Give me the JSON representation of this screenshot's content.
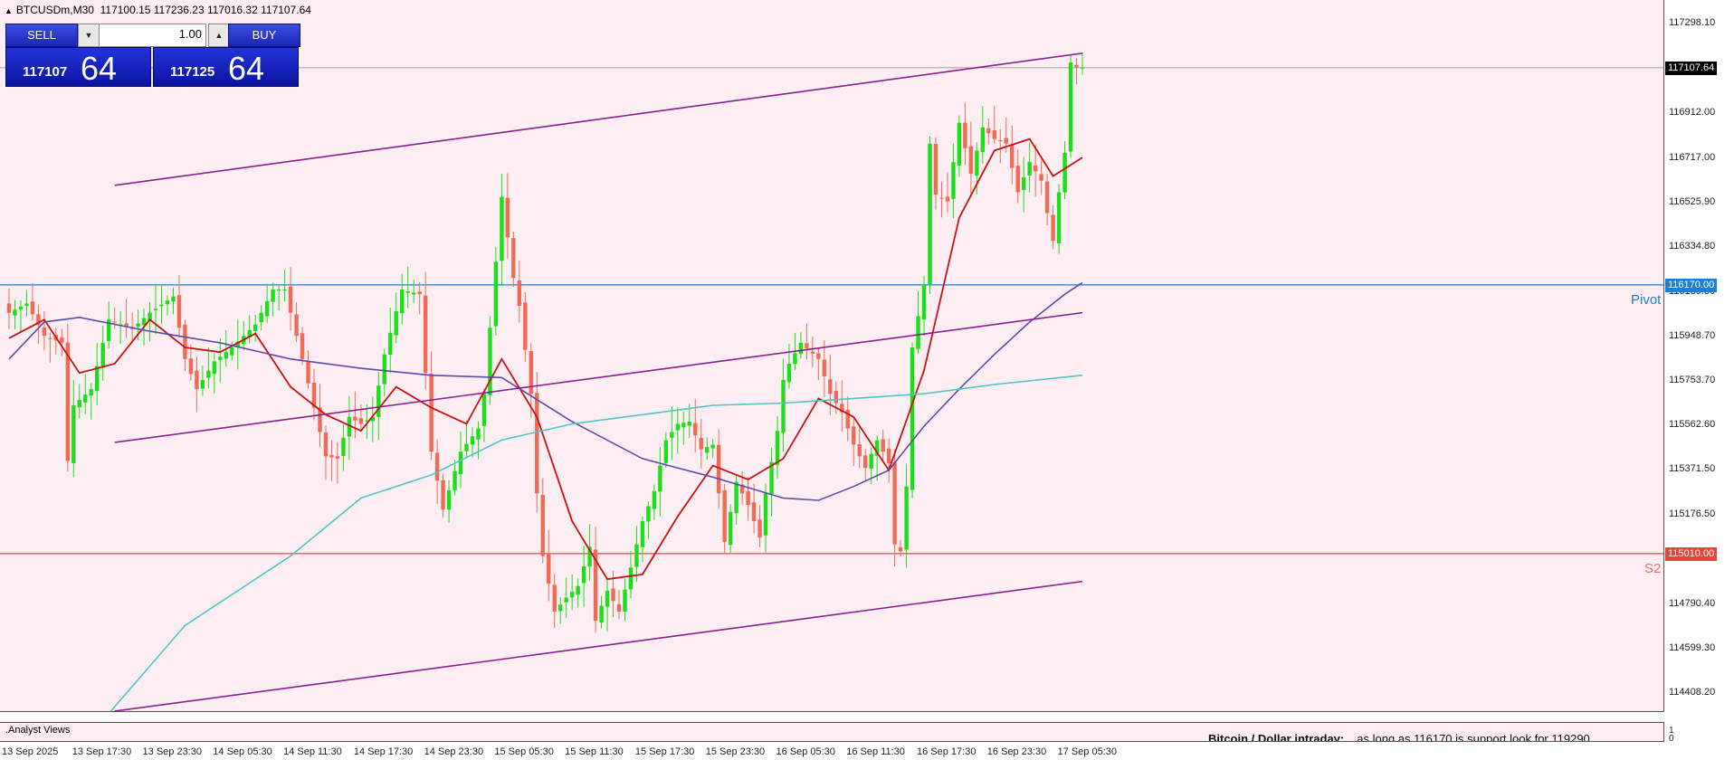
{
  "header": {
    "symbol": "BTCUSDm,M30",
    "ohlc": "117100.15 117236.23 117016.32 117107.64"
  },
  "trade_panel": {
    "sell_label": "SELL",
    "buy_label": "BUY",
    "lot_value": "1.00",
    "sell_price_main": "117107",
    "sell_price_big": "64",
    "buy_price_main": "117125",
    "buy_price_big": "64",
    "down_glyph": "▼",
    "up_glyph": "▲"
  },
  "levels": {
    "current_price": "117107.64",
    "pivot_label": "Pivot",
    "pivot_value": "116170.00",
    "s2_label": "S2",
    "s2_value": "115010.00"
  },
  "sub_panel": {
    "title": ".Analyst Views",
    "scale_top": "1",
    "scale_bottom": "0",
    "analyst_heading": "Bitcoin / Dollar intraday:",
    "analyst_body": "as long as 116170 is support look for 119290"
  },
  "colors": {
    "background": "#fdeef3",
    "bull": "#19e019",
    "bear": "#ef6b55",
    "ma_fast": "#cc1111",
    "ma_mid": "#5a4bb0",
    "ma_slow": "#4ec5c8",
    "channel": "#8d1d8f",
    "pivot": "#1f7fd0",
    "s2": "#e5463b"
  },
  "chart_data": {
    "type": "candlestick",
    "timeframe": "M30",
    "y_ticks": [
      117298.1,
      116912.0,
      116717.0,
      116525.9,
      116334.8,
      116139.8,
      115948.7,
      115753.7,
      115562.6,
      115371.5,
      115176.5,
      114985.4,
      114790.4,
      114599.3,
      114408.2
    ],
    "y_tick_labels": [
      "117298.10",
      "116912.00",
      "116717.00",
      "116525.90",
      "116334.80",
      "116139.80",
      "115948.70",
      "115753.70",
      "115562.60",
      "115371.50",
      "115176.50",
      "114985.40",
      "114790.40",
      "114599.30",
      "114408.20"
    ],
    "ylim": [
      114330,
      117400
    ],
    "x_labels": [
      "13 Sep 2025",
      "13 Sep 17:30",
      "13 Sep 23:30",
      "14 Sep 05:30",
      "14 Sep 11:30",
      "14 Sep 17:30",
      "14 Sep 23:30",
      "15 Sep 05:30",
      "15 Sep 11:30",
      "15 Sep 17:30",
      "15 Sep 23:30",
      "16 Sep 05:30",
      "16 Sep 11:30",
      "16 Sep 17:30",
      "16 Sep 23:30",
      "17 Sep 05:30"
    ],
    "x_label_bars": [
      0,
      12,
      24,
      36,
      48,
      60,
      72,
      84,
      96,
      108,
      120,
      132,
      144,
      156,
      168,
      180
    ],
    "bars_total": 184,
    "waypoints": [
      [
        0,
        116050
      ],
      [
        3,
        116090
      ],
      [
        6,
        115950
      ],
      [
        9,
        115920
      ],
      [
        10,
        115410
      ],
      [
        11,
        115650
      ],
      [
        14,
        115720
      ],
      [
        17,
        116020
      ],
      [
        21,
        115980
      ],
      [
        24,
        116050
      ],
      [
        28,
        116120
      ],
      [
        30,
        115850
      ],
      [
        32,
        115720
      ],
      [
        35,
        115840
      ],
      [
        38,
        115900
      ],
      [
        42,
        116000
      ],
      [
        45,
        116150
      ],
      [
        47,
        116150
      ],
      [
        50,
        115850
      ],
      [
        54,
        115430
      ],
      [
        56,
        115420
      ],
      [
        58,
        115600
      ],
      [
        60,
        115570
      ],
      [
        62,
        115600
      ],
      [
        64,
        115870
      ],
      [
        67,
        116150
      ],
      [
        70,
        116130
      ],
      [
        72,
        115450
      ],
      [
        74,
        115200
      ],
      [
        77,
        115450
      ],
      [
        80,
        115550
      ],
      [
        81,
        115700
      ],
      [
        83,
        116270
      ],
      [
        84,
        116550
      ],
      [
        86,
        116200
      ],
      [
        87,
        116080
      ],
      [
        89,
        115700
      ],
      [
        90,
        115270
      ],
      [
        91,
        115000
      ],
      [
        93,
        114760
      ],
      [
        95,
        114820
      ],
      [
        97,
        114870
      ],
      [
        99,
        115040
      ],
      [
        100,
        114720
      ],
      [
        102,
        114850
      ],
      [
        104,
        114760
      ],
      [
        106,
        114950
      ],
      [
        108,
        115150
      ],
      [
        110,
        115280
      ],
      [
        112,
        115500
      ],
      [
        114,
        115570
      ],
      [
        116,
        115580
      ],
      [
        118,
        115460
      ],
      [
        120,
        115480
      ],
      [
        122,
        115060
      ],
      [
        124,
        115320
      ],
      [
        126,
        115220
      ],
      [
        128,
        115080
      ],
      [
        129,
        115270
      ],
      [
        131,
        115540
      ],
      [
        132,
        115760
      ],
      [
        133,
        115830
      ],
      [
        135,
        115920
      ],
      [
        138,
        115850
      ],
      [
        140,
        115700
      ],
      [
        142,
        115620
      ],
      [
        144,
        115480
      ],
      [
        146,
        115380
      ],
      [
        148,
        115500
      ],
      [
        150,
        115400
      ],
      [
        151,
        115050
      ],
      [
        152,
        115020
      ],
      [
        153,
        115300
      ],
      [
        154,
        115900
      ],
      [
        156,
        116170
      ],
      [
        157,
        116780
      ],
      [
        158,
        116560
      ],
      [
        160,
        116530
      ],
      [
        162,
        116870
      ],
      [
        164,
        116650
      ],
      [
        166,
        116850
      ],
      [
        168,
        116800
      ],
      [
        170,
        116780
      ],
      [
        172,
        116570
      ],
      [
        174,
        116700
      ],
      [
        176,
        116620
      ],
      [
        177,
        116480
      ],
      [
        178,
        116360
      ],
      [
        179,
        116570
      ],
      [
        180,
        116740
      ],
      [
        181,
        117130
      ],
      [
        182,
        117110
      ],
      [
        183,
        117107.64
      ]
    ],
    "moving_averages": [
      {
        "name": "",
        "color": "#cc1111",
        "points": [
          [
            0,
            115940
          ],
          [
            6,
            116020
          ],
          [
            12,
            115790
          ],
          [
            18,
            115830
          ],
          [
            24,
            116020
          ],
          [
            30,
            115900
          ],
          [
            36,
            115880
          ],
          [
            42,
            115960
          ],
          [
            48,
            115730
          ],
          [
            54,
            115610
          ],
          [
            60,
            115540
          ],
          [
            66,
            115730
          ],
          [
            72,
            115640
          ],
          [
            78,
            115570
          ],
          [
            84,
            115850
          ],
          [
            90,
            115600
          ],
          [
            96,
            115150
          ],
          [
            102,
            114900
          ],
          [
            108,
            114920
          ],
          [
            114,
            115170
          ],
          [
            120,
            115390
          ],
          [
            126,
            115330
          ],
          [
            132,
            115420
          ],
          [
            138,
            115680
          ],
          [
            144,
            115600
          ],
          [
            150,
            115370
          ],
          [
            156,
            115800
          ],
          [
            162,
            116460
          ],
          [
            168,
            116750
          ],
          [
            174,
            116800
          ],
          [
            178,
            116640
          ],
          [
            183,
            116720
          ]
        ]
      },
      {
        "name": "",
        "color": "#5a4bb0",
        "points": [
          [
            0,
            115850
          ],
          [
            6,
            116010
          ],
          [
            12,
            116030
          ],
          [
            24,
            115970
          ],
          [
            36,
            115920
          ],
          [
            48,
            115850
          ],
          [
            60,
            115810
          ],
          [
            72,
            115780
          ],
          [
            84,
            115770
          ],
          [
            96,
            115580
          ],
          [
            108,
            115420
          ],
          [
            120,
            115340
          ],
          [
            132,
            115250
          ],
          [
            138,
            115240
          ],
          [
            144,
            115300
          ],
          [
            150,
            115370
          ],
          [
            156,
            115560
          ],
          [
            162,
            115720
          ],
          [
            168,
            115870
          ],
          [
            174,
            116010
          ],
          [
            180,
            116130
          ],
          [
            183,
            116180
          ]
        ]
      },
      {
        "name": "",
        "color": "#4ec5c8",
        "points": [
          [
            17,
            114320
          ],
          [
            30,
            114700
          ],
          [
            48,
            115000
          ],
          [
            60,
            115250
          ],
          [
            72,
            115350
          ],
          [
            84,
            115500
          ],
          [
            96,
            115570
          ],
          [
            108,
            115610
          ],
          [
            120,
            115650
          ],
          [
            132,
            115660
          ],
          [
            144,
            115680
          ],
          [
            156,
            115700
          ],
          [
            168,
            115740
          ],
          [
            183,
            115780
          ]
        ]
      }
    ],
    "channel_lines": [
      [
        [
          18,
          116600
        ],
        [
          183,
          117170
        ]
      ],
      [
        [
          18,
          115490
        ],
        [
          183,
          116050
        ]
      ],
      [
        [
          18,
          114330
        ],
        [
          183,
          114890
        ]
      ]
    ],
    "horizontal_lines": [
      {
        "name": "Pivot",
        "value": 116170.0,
        "color": "#1f7fd0"
      },
      {
        "name": "S2",
        "value": 115010.0,
        "color": "#e5463b"
      },
      {
        "name": "",
        "value": 117107.64,
        "color": "#888888"
      }
    ]
  }
}
